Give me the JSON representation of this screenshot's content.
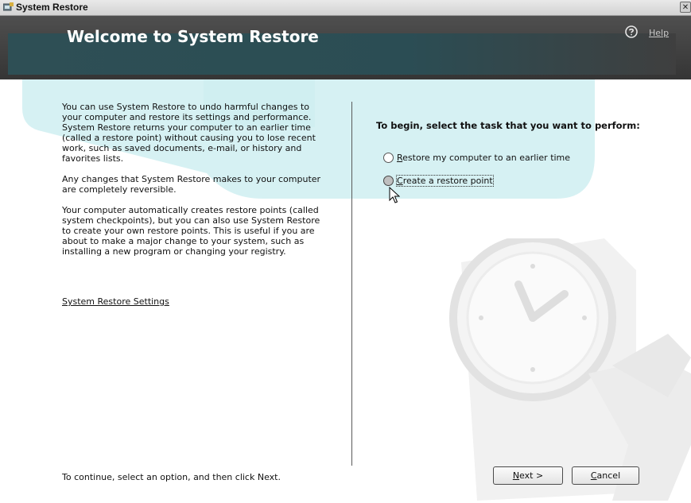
{
  "window": {
    "title": "System Restore",
    "close_glyph": "✕"
  },
  "banner": {
    "title": "Welcome to System Restore",
    "help_label": "Help",
    "help_icon": "help-circle-icon"
  },
  "intro": {
    "paragraphs": [
      "You can use System Restore to undo harmful changes to your computer and restore its settings and performance. System Restore returns your computer to an earlier time (called a restore point) without causing you to lose recent work, such as saved documents, e-mail, or history and favorites lists.",
      "Any changes that System Restore makes to your computer are completely reversible.",
      "Your computer automatically creates restore points (called system checkpoints), but you can also use System Restore to create your own restore points. This is useful if you are about to make a major change to your system, such as installing a new program or changing your registry."
    ],
    "settings_link": "System Restore Settings"
  },
  "tasks": {
    "prompt": "To begin, select the task that you want to perform:",
    "options": [
      {
        "accel": "R",
        "rest": "estore my computer to an earlier time",
        "selected": false
      },
      {
        "accel": "C",
        "rest": "reate a restore point",
        "selected": false,
        "hovered": true
      }
    ]
  },
  "footer": {
    "instruction": "To continue, select an option, and then click Next.",
    "next_accel": "N",
    "next_rest": "ext >",
    "cancel_accel": "C",
    "cancel_rest": "ancel"
  },
  "colors": {
    "banner_dark": "#353535",
    "heading_teal": "#2b4d54",
    "ribbon_cyan": "#cfeef1",
    "text": "#111111"
  }
}
